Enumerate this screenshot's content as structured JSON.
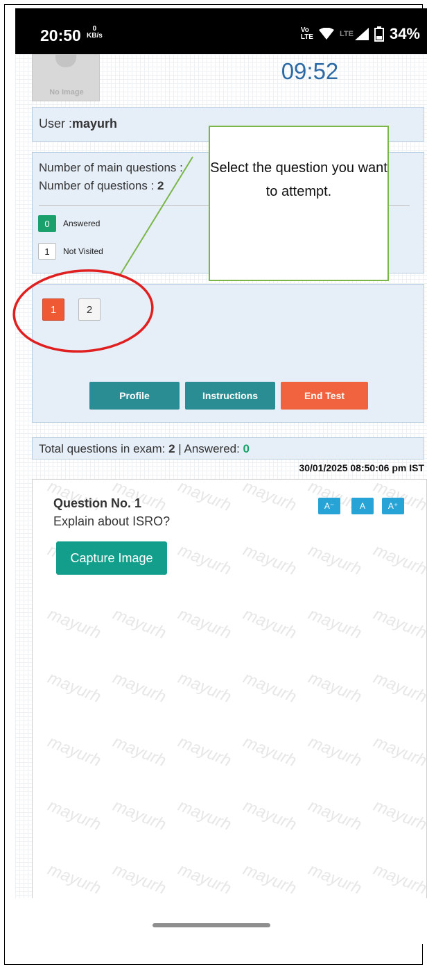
{
  "status_bar": {
    "time": "20:50",
    "speed_value": "0",
    "speed_unit": "KB/s",
    "volte": "Vo) LTE",
    "lte": "LTE",
    "battery": "34%"
  },
  "header": {
    "no_image_label": "No Image",
    "timer": "09:52"
  },
  "user": {
    "label": "User :",
    "name": "mayurh"
  },
  "summary": {
    "main_questions_label": "Number of main questions :",
    "questions_label": "Number of questions :",
    "questions_count": "2",
    "answered_count": "0",
    "answered_label": "Answered",
    "not_visited_count": "1",
    "not_visited_label": "Not Visited"
  },
  "question_palette": [
    {
      "number": "1"
    },
    {
      "number": "2"
    }
  ],
  "actions": {
    "profile": "Profile",
    "instructions": "Instructions",
    "end_test": "End Test"
  },
  "totals": {
    "prefix": "Total questions in exam: ",
    "total": "2",
    "mid": " | Answered: ",
    "answered": "0"
  },
  "datetime": "30/01/2025 08:50:06 pm IST",
  "question": {
    "title": "Question No. 1",
    "text": "Explain about ISRO?",
    "font_decrease": "A⁻",
    "font_normal": "A",
    "font_increase": "A⁺",
    "capture_button": "Capture Image",
    "watermark": "mayurh"
  },
  "annotation": {
    "text": "Select the question you want to attempt.",
    "colors": {
      "box": "#7ab648",
      "circle": "#e02020"
    }
  }
}
